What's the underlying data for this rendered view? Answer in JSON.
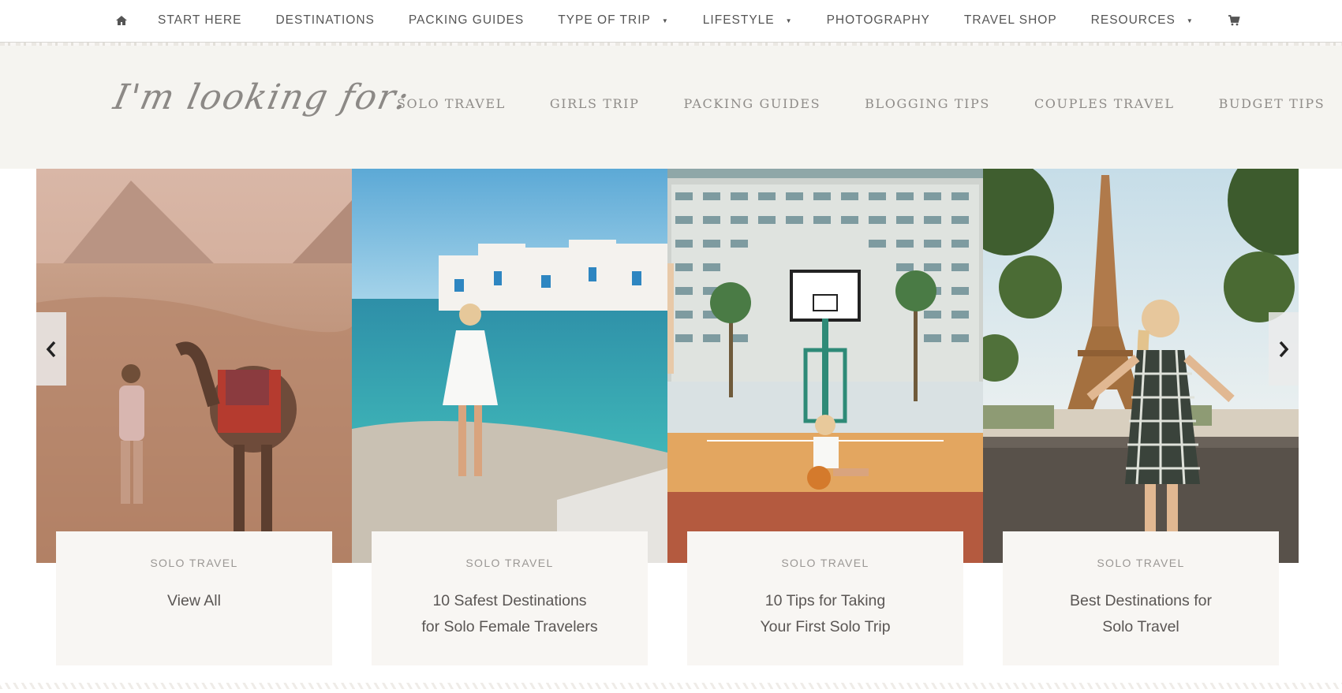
{
  "topnav": {
    "items": [
      {
        "label": "START HERE",
        "caret": false
      },
      {
        "label": "DESTINATIONS",
        "caret": false
      },
      {
        "label": "PACKING GUIDES",
        "caret": false
      },
      {
        "label": "TYPE OF TRIP",
        "caret": true
      },
      {
        "label": "LIFESTYLE",
        "caret": true
      },
      {
        "label": "PHOTOGRAPHY",
        "caret": false
      },
      {
        "label": "TRAVEL SHOP",
        "caret": false
      },
      {
        "label": "RESOURCES",
        "caret": true
      }
    ],
    "home_icon": "home-icon",
    "cart_icon": "cart-icon"
  },
  "looking_for": {
    "heading": "I'm looking for:",
    "links": [
      "SOLO TRAVEL",
      "GIRLS TRIP",
      "PACKING GUIDES",
      "BLOGGING TIPS",
      "COUPLES TRAVEL",
      "BUDGET TIPS"
    ]
  },
  "carousel": {
    "prev_icon": "chevron-left-icon",
    "next_icon": "chevron-right-icon",
    "cards": [
      {
        "category": "SOLO TRAVEL",
        "title": "View All"
      },
      {
        "category": "SOLO TRAVEL",
        "title": "10 Safest Destinations\nfor Solo Female Travelers"
      },
      {
        "category": "SOLO TRAVEL",
        "title": "10 Tips for Taking\nYour First Solo Trip"
      },
      {
        "category": "SOLO TRAVEL",
        "title": "Best Destinations for\nSolo Travel"
      }
    ]
  }
}
